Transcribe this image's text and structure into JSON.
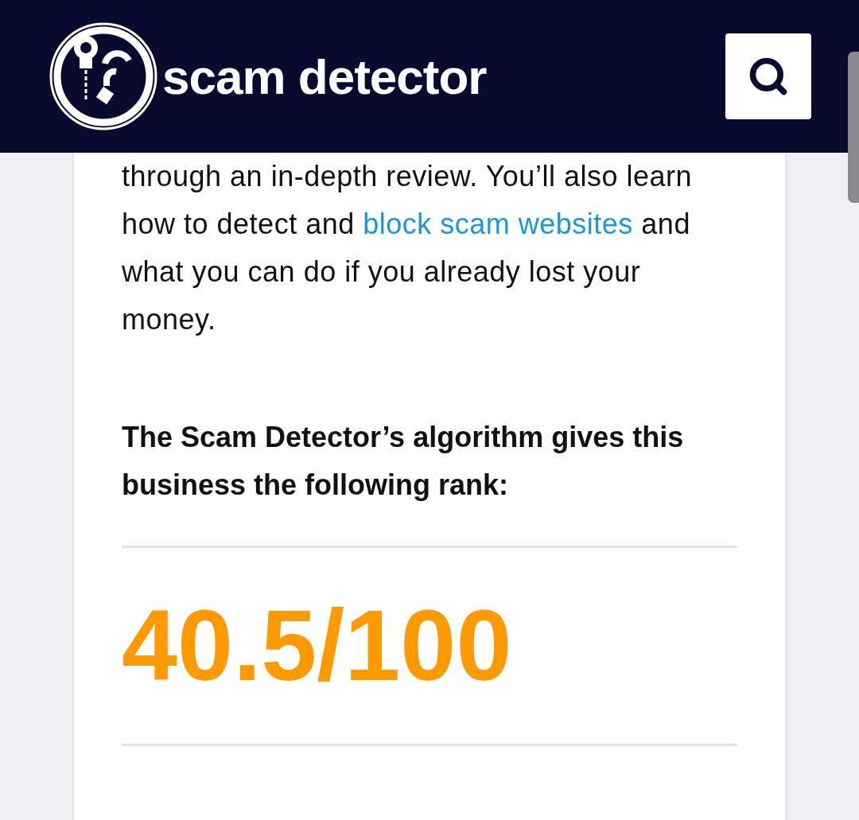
{
  "header": {
    "logo_text": "scam detector"
  },
  "intro": [
    {
      "kind": "text",
      "text": "through an in-depth review. You’ll also learn how to detect and "
    },
    {
      "kind": "link",
      "text": "block scam websites"
    },
    {
      "kind": "text",
      "text": " and what you can do if you already lost your money."
    }
  ],
  "rank_heading": "The Scam Detector’s algorithm gives this business the following rank:",
  "score": "40.5/100"
}
